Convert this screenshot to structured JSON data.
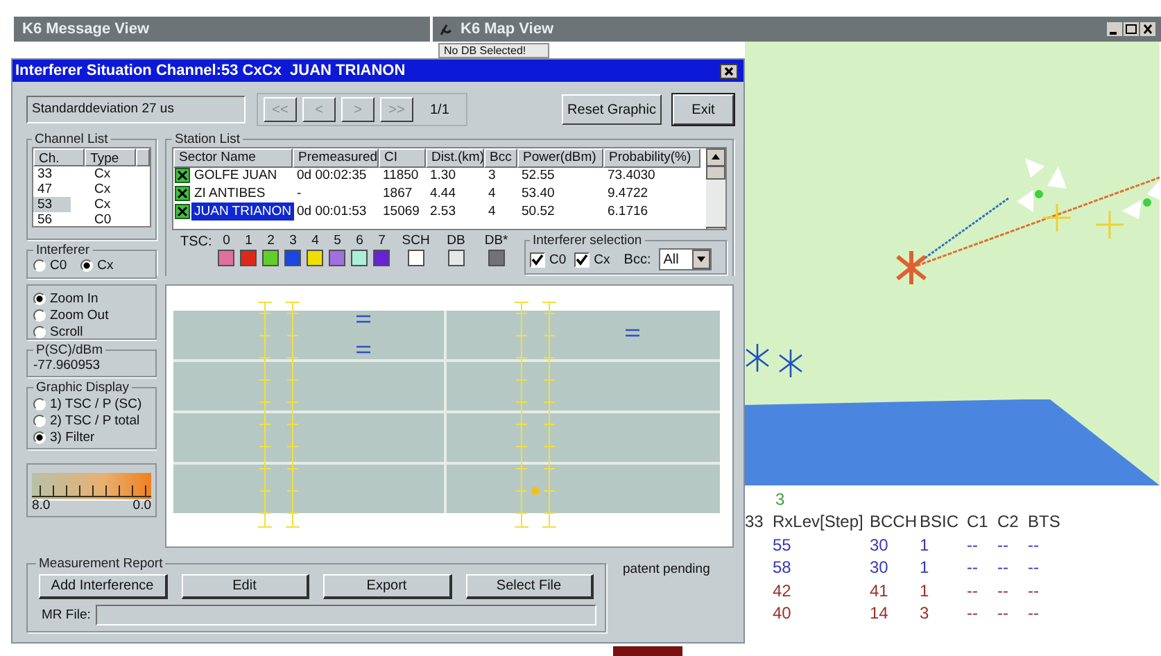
{
  "message_view": {
    "title": "K6 Message View"
  },
  "map_view": {
    "title": "K6 Map View",
    "status": "No DB Selected!"
  },
  "measurements": {
    "above": [
      {
        "text": "3",
        "color": "#40a040"
      }
    ],
    "columns": [
      "33",
      "RxLev[Step]",
      "BCCH",
      "BSIC",
      "C1",
      "C2",
      "BTS"
    ],
    "rows": [
      {
        "color": "#3838b8",
        "cells": [
          "",
          "55",
          "30",
          "1",
          "--",
          "--",
          "--"
        ]
      },
      {
        "color": "#3838b8",
        "cells": [
          "",
          "58",
          "30",
          "1",
          "--",
          "--",
          "--"
        ]
      },
      {
        "color": "#983028",
        "cells": [
          "",
          "42",
          "41",
          "1",
          "--",
          "--",
          "--"
        ]
      },
      {
        "color": "#983028",
        "cells": [
          "",
          "40",
          "14",
          "3",
          "--",
          "--",
          "--"
        ]
      }
    ]
  },
  "dialog": {
    "title": "Interferer Situation Channel:53 CxCx  JUAN TRIANON",
    "std_field": "Standarddeviation 27 us",
    "nav_buttons": [
      {
        "label": "<<",
        "disabled": true
      },
      {
        "label": "<",
        "disabled": true
      },
      {
        "label": ">",
        "disabled": true
      },
      {
        "label": ">>",
        "disabled": true
      }
    ],
    "page": "1/1",
    "buttons": [
      "Reset Graphic",
      "Exit"
    ],
    "channel_list": {
      "title": "Channel List",
      "columns": [
        "Ch.",
        "Type"
      ],
      "rows": [
        {
          "cells": [
            "33",
            "Cx"
          ],
          "selected": false
        },
        {
          "cells": [
            "47",
            "Cx"
          ],
          "selected": false
        },
        {
          "cells": [
            "53",
            "Cx"
          ],
          "selected": true
        },
        {
          "cells": [
            "56",
            "C0"
          ],
          "selected": false
        }
      ]
    },
    "interferer": {
      "title": "Interferer",
      "options": [
        {
          "label": "C0",
          "selected": false
        },
        {
          "label": "Cx",
          "selected": true
        }
      ]
    },
    "station_list": {
      "title": "Station List",
      "columns": [
        "Sector Name",
        "Premeasured",
        "CI",
        "Dist.(km)",
        "Bcc",
        "Power(dBm)",
        "Probability(%)"
      ],
      "rows": [
        {
          "checked": true,
          "selected": false,
          "cells": [
            "GOLFE JUAN",
            "0d 00:02:35",
            "11850",
            "1.30",
            "3",
            "52.55",
            "73.4030"
          ]
        },
        {
          "checked": true,
          "selected": false,
          "cells": [
            "ZI ANTIBES",
            "-",
            "1867",
            "4.44",
            "4",
            "53.40",
            "9.4722"
          ]
        },
        {
          "checked": true,
          "selected": true,
          "cells": [
            "JUAN TRIANON",
            "0d 00:01:53",
            "15069",
            "2.53",
            "4",
            "50.52",
            "6.1716"
          ]
        }
      ]
    },
    "tsc_legend": {
      "label": "TSC:",
      "items": [
        {
          "label": "0",
          "color": "#e070a0"
        },
        {
          "label": "1",
          "color": "#e02818"
        },
        {
          "label": "2",
          "color": "#60d028"
        },
        {
          "label": "3",
          "color": "#1848e0"
        },
        {
          "label": "4",
          "color": "#f0e000"
        },
        {
          "label": "5",
          "color": "#a070e0"
        },
        {
          "label": "6",
          "color": "#a8f0d8"
        },
        {
          "label": "7",
          "color": "#6820d8"
        },
        {
          "label": "SCH",
          "color": "#ffffff"
        },
        {
          "label": "DB",
          "color": "#e4e8e8"
        },
        {
          "label": "DB*",
          "color": "#707478"
        }
      ]
    },
    "interferer_selection": {
      "title": "Interferer selection",
      "options": [
        {
          "label": "C0",
          "checked": true
        },
        {
          "label": "Cx",
          "checked": true
        }
      ],
      "bcc_label": "Bcc:",
      "bcc_value": "All"
    },
    "mode": {
      "options": [
        {
          "label": "Zoom In",
          "selected": true
        },
        {
          "label": "Zoom Out",
          "selected": false
        },
        {
          "label": "Scroll",
          "selected": false
        }
      ]
    },
    "psc": {
      "title": "P(SC)/dBm",
      "value": "-77.960953"
    },
    "graphic_display": {
      "title": "Graphic Display",
      "options": [
        {
          "label": "1) TSC / P (SC)",
          "selected": false
        },
        {
          "label": "2) TSC / P total",
          "selected": false
        },
        {
          "label": "3) Filter",
          "selected": true
        }
      ]
    },
    "scale": {
      "min_label": "8.0",
      "max_label": "0.0"
    },
    "measurement_report": {
      "title": "Measurement Report",
      "buttons": [
        "Add Interference",
        "Edit",
        "Export",
        "Select File"
      ],
      "file_label": "MR File:"
    },
    "note": "patent pending"
  }
}
